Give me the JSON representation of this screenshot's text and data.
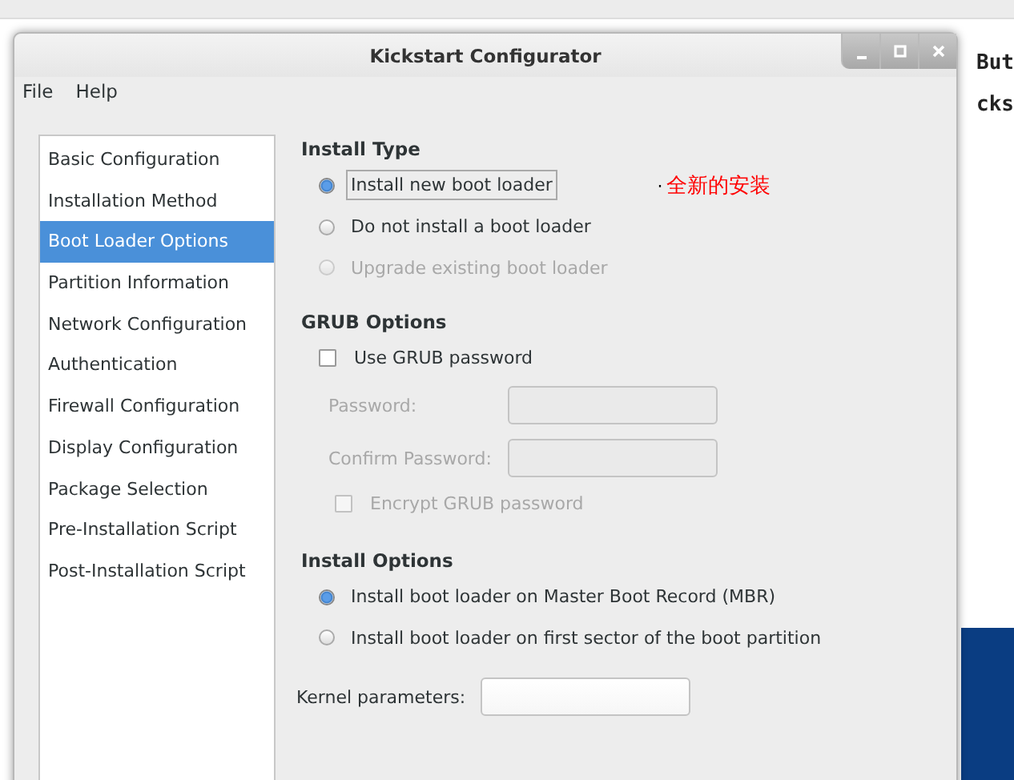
{
  "terminal": {
    "right_fragments": [
      "But",
      "cks"
    ]
  },
  "dialog": {
    "title": "Kickstart Configurator",
    "menu": [
      "File",
      "Help"
    ],
    "sidebar": [
      {
        "label": "Basic Configuration",
        "selected": false
      },
      {
        "label": "Installation Method",
        "selected": false
      },
      {
        "label": "Boot Loader Options",
        "selected": true
      },
      {
        "label": "Partition Information",
        "selected": false
      },
      {
        "label": "Network Configuration",
        "selected": false
      },
      {
        "label": "Authentication",
        "selected": false
      },
      {
        "label": "Firewall Configuration",
        "selected": false
      },
      {
        "label": "Display Configuration",
        "selected": false
      },
      {
        "label": "Package Selection",
        "selected": false
      },
      {
        "label": "Pre-Installation Script",
        "selected": false
      },
      {
        "label": "Post-Installation Script",
        "selected": false
      }
    ],
    "install_type": {
      "title": "Install Type",
      "options": [
        {
          "label": "Install new boot loader",
          "selected": true,
          "disabled": false,
          "focused": true
        },
        {
          "label": "Do not install a boot loader",
          "selected": false,
          "disabled": false,
          "focused": false
        },
        {
          "label": "Upgrade existing boot loader",
          "selected": false,
          "disabled": true,
          "focused": false
        }
      ]
    },
    "annotation": {
      "mark": "·",
      "text": "全新的安装"
    },
    "grub": {
      "title": "GRUB Options",
      "use_password": {
        "label": "Use GRUB password",
        "checked": false
      },
      "fields": [
        {
          "label": "Password:",
          "disabled": true
        },
        {
          "label": "Confirm Password:",
          "disabled": true
        }
      ],
      "encrypt": {
        "label": "Encrypt GRUB password",
        "checked": false,
        "disabled": true
      }
    },
    "install_options": {
      "title": "Install Options",
      "options": [
        {
          "label": "Install boot loader on Master Boot Record (MBR)",
          "selected": true,
          "disabled": false,
          "focused": false
        },
        {
          "label": "Install boot loader on first sector of the boot partition",
          "selected": false,
          "disabled": false,
          "focused": false
        }
      ]
    },
    "kernel": {
      "label": "Kernel parameters:"
    }
  }
}
